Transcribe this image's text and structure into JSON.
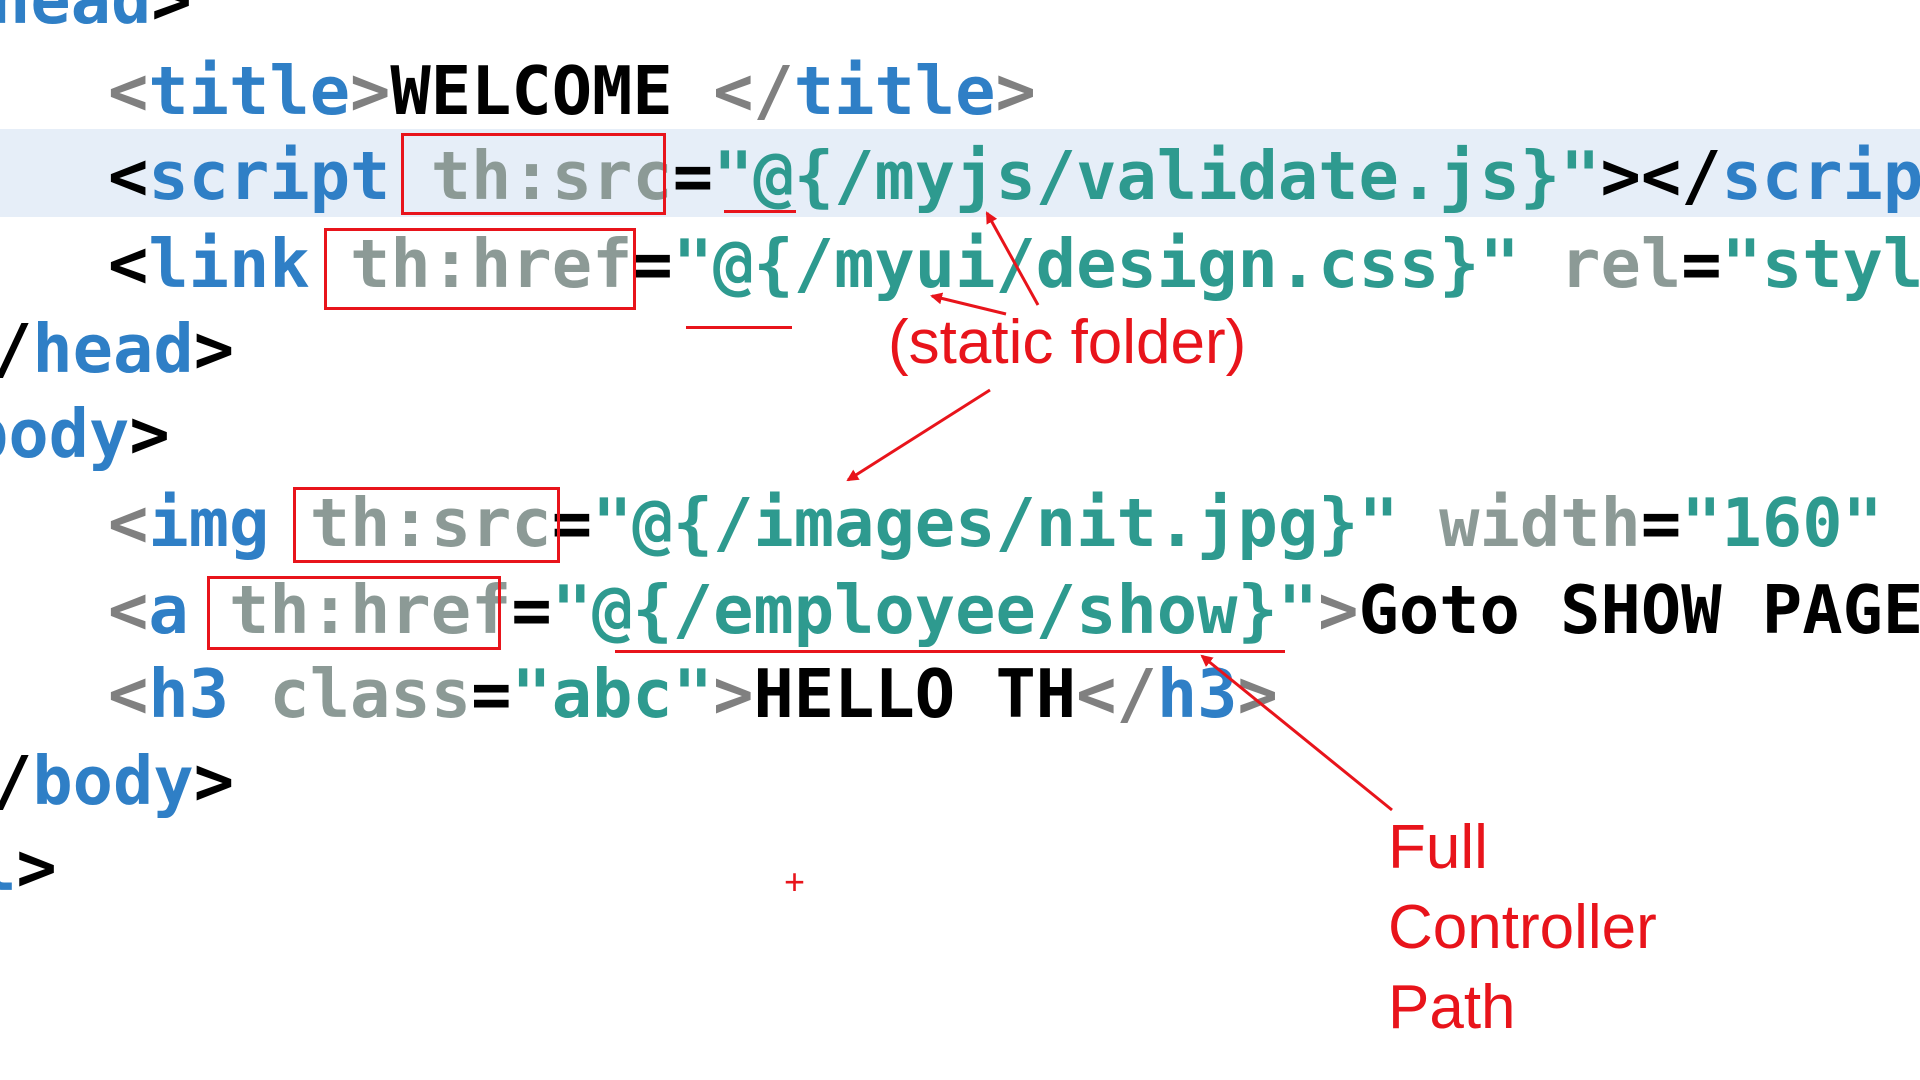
{
  "code": {
    "lines": [
      {
        "id": "head-open",
        "tokens": [
          {
            "c": "tag",
            "t": "head"
          },
          {
            "c": "br",
            "t": ">"
          }
        ]
      },
      {
        "id": "title",
        "tokens": [
          {
            "c": "brg",
            "t": "<"
          },
          {
            "c": "tag",
            "t": "title"
          },
          {
            "c": "brg",
            "t": ">"
          },
          {
            "c": "txt",
            "t": "WELCOME "
          },
          {
            "c": "brg",
            "t": "</"
          },
          {
            "c": "tag",
            "t": "title"
          },
          {
            "c": "brg",
            "t": ">"
          }
        ]
      },
      {
        "id": "script",
        "tokens": [
          {
            "c": "br",
            "t": "<"
          },
          {
            "c": "tag",
            "t": "script"
          },
          {
            "c": "attr",
            "t": " th:src"
          },
          {
            "c": "eq",
            "t": "="
          },
          {
            "c": "val",
            "t": "\"@{/myjs/validate.js}\""
          },
          {
            "c": "br",
            "t": "></"
          },
          {
            "c": "tag",
            "t": "script"
          }
        ]
      },
      {
        "id": "link",
        "tokens": [
          {
            "c": "br",
            "t": "<"
          },
          {
            "c": "tag",
            "t": "link"
          },
          {
            "c": "attr",
            "t": " th:href"
          },
          {
            "c": "eq",
            "t": "="
          },
          {
            "c": "val",
            "t": "\"@{/myui/design.css}\""
          },
          {
            "c": "attr",
            "t": " rel"
          },
          {
            "c": "eq",
            "t": "="
          },
          {
            "c": "val",
            "t": "\"style"
          }
        ]
      },
      {
        "id": "head-close",
        "tokens": [
          {
            "c": "br",
            "t": "/"
          },
          {
            "c": "tag",
            "t": "head"
          },
          {
            "c": "br",
            "t": ">"
          }
        ]
      },
      {
        "id": "body-open",
        "tokens": [
          {
            "c": "tag",
            "t": "body"
          },
          {
            "c": "br",
            "t": ">"
          }
        ]
      },
      {
        "id": "img",
        "tokens": [
          {
            "c": "brg",
            "t": "<"
          },
          {
            "c": "tag",
            "t": "img"
          },
          {
            "c": "attr",
            "t": " th:src"
          },
          {
            "c": "eq",
            "t": "="
          },
          {
            "c": "val",
            "t": "\"@{/images/nit.jpg}\""
          },
          {
            "c": "attr",
            "t": " width"
          },
          {
            "c": "eq",
            "t": "="
          },
          {
            "c": "val",
            "t": "\"160\""
          }
        ]
      },
      {
        "id": "anchor",
        "tokens": [
          {
            "c": "brg",
            "t": "<"
          },
          {
            "c": "tag",
            "t": "a"
          },
          {
            "c": "attr",
            "t": " th:href"
          },
          {
            "c": "eq",
            "t": "="
          },
          {
            "c": "val",
            "t": "\"@{/employee/show}\""
          },
          {
            "c": "brg",
            "t": ">"
          },
          {
            "c": "txt",
            "t": "Goto SHOW PAGE"
          },
          {
            "c": "brg",
            "t": "<"
          }
        ]
      },
      {
        "id": "h3",
        "tokens": [
          {
            "c": "brg",
            "t": "<"
          },
          {
            "c": "tag",
            "t": "h3"
          },
          {
            "c": "attr",
            "t": " class"
          },
          {
            "c": "eq",
            "t": "="
          },
          {
            "c": "val",
            "t": "\"abc\""
          },
          {
            "c": "brg",
            "t": ">"
          },
          {
            "c": "txt",
            "t": "HELLO TH"
          },
          {
            "c": "brg",
            "t": "</"
          },
          {
            "c": "tag",
            "t": "h3"
          },
          {
            "c": "brg",
            "t": ">"
          }
        ]
      },
      {
        "id": "body-close",
        "tokens": [
          {
            "c": "br",
            "t": "/"
          },
          {
            "c": "tag",
            "t": "body"
          },
          {
            "c": "br",
            "t": ">"
          }
        ]
      },
      {
        "id": "html-close",
        "tokens": [
          {
            "c": "tag",
            "t": "l"
          },
          {
            "c": "br",
            "t": ">"
          }
        ]
      }
    ]
  },
  "annotations": {
    "static_note": "(static folder)",
    "controller_note_line1": "Full",
    "controller_note_line2": "Controller",
    "controller_note_line3": "Path",
    "cursor_glyph": "+"
  },
  "colors": {
    "annotation": "#e8141b",
    "tag": "#2f7fc6",
    "attribute": "#8c9a96",
    "value": "#2e9a8f",
    "highlight_line": "#e6eef8"
  }
}
